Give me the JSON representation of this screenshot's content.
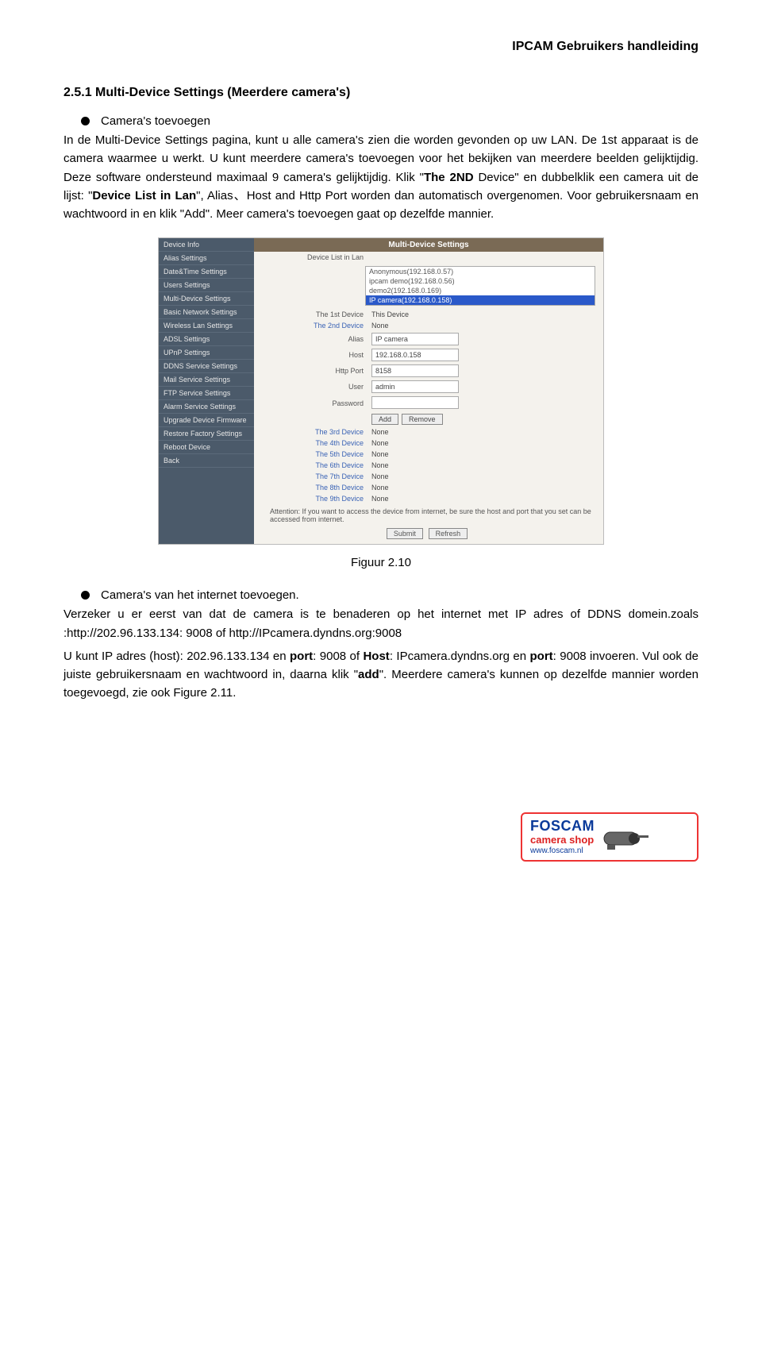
{
  "header": {
    "title": "IPCAM Gebruikers handleiding"
  },
  "section": {
    "heading": "2.5.1 Multi-Device Settings (Meerdere camera's)"
  },
  "bullet1": {
    "text": "Camera's toevoegen"
  },
  "para1": {
    "t1": "In de Multi-Device Settings pagina, kunt u alle camera's zien die worden gevonden op uw LAN. De 1st apparaat is de camera waarmee u werkt. U kunt meerdere camera's toevoegen voor het bekijken van meerdere beelden gelijktijdig. Deze software ondersteund maximaal 9 camera's gelijktijdig. Klik \"",
    "b1": "The 2ND",
    "t2": " Device\" en dubbelklik een camera uit de lijst: \"",
    "b2": "Device List in Lan",
    "t3": "\", Alias、Host and Http Port worden dan automatisch overgenomen. Voor gebruikersnaam en wachtwoord in en klik \"Add\". Meer camera's toevoegen gaat op dezelfde mannier."
  },
  "fig1": {
    "caption": "Figuur 2.10"
  },
  "bullet2": {
    "text": "Camera's van het internet toevoegen."
  },
  "para2": {
    "t1": "Verzeker u er eerst van dat de camera is te benaderen op het internet met IP adres of DDNS domein.zoals :http://202.96.133.134: 9008 of http://IPcamera.dyndns.org:9008",
    "t2a": "U kunt IP adres (host): 202.96.133.134 en ",
    "b2a": "port",
    "t2b": ": 9008 of ",
    "b2b": "Host",
    "t2c": ": IPcamera.dyndns.org en ",
    "b2c": "port",
    "t2d": ": 9008 invoeren. Vul ook de juiste gebruikersnaam en wachtwoord in, daarna klik \"",
    "b2d": "add",
    "t2e": "\". Meerdere camera's kunnen op dezelfde mannier worden toegevoegd, zie ook Figure 2.11."
  },
  "shot": {
    "sidebar": [
      "Device Info",
      "Alias Settings",
      "Date&Time Settings",
      "Users Settings",
      "Multi-Device Settings",
      "Basic Network Settings",
      "Wireless Lan Settings",
      "ADSL Settings",
      "UPnP Settings",
      "DDNS Service Settings",
      "Mail Service Settings",
      "FTP Service Settings",
      "Alarm Service Settings",
      "Upgrade Device Firmware",
      "Restore Factory Settings",
      "Reboot Device",
      "Back"
    ],
    "title": "Multi-Device Settings",
    "listLabel": "Device List in Lan",
    "listItems": [
      "Anonymous(192.168.0.57)",
      "ipcam demo(192.168.0.56)",
      "demo2(192.168.0.169)",
      "IP camera(192.168.0.158)"
    ],
    "dev1": "The 1st Device",
    "dev1v": "This Device",
    "dev2": "The 2nd Device",
    "dev2v": "None",
    "aliasL": "Alias",
    "aliasV": "IP camera",
    "hostL": "Host",
    "hostV": "192.168.0.158",
    "portL": "Http Port",
    "portV": "8158",
    "userL": "User",
    "userV": "admin",
    "passL": "Password",
    "addBtn": "Add",
    "removeBtn": "Remove",
    "devs": [
      "The 3rd Device",
      "The 4th Device",
      "The 5th Device",
      "The 6th Device",
      "The 7th Device",
      "The 8th Device",
      "The 9th Device"
    ],
    "none": "None",
    "attn": "Attention: If you want to access the device from internet, be sure the host and port that you set can be accessed from internet.",
    "submit": "Submit",
    "refresh": "Refresh"
  },
  "logo": {
    "l1": "FOSCAM",
    "l2": "camera shop",
    "l3": "www.foscam.nl"
  }
}
